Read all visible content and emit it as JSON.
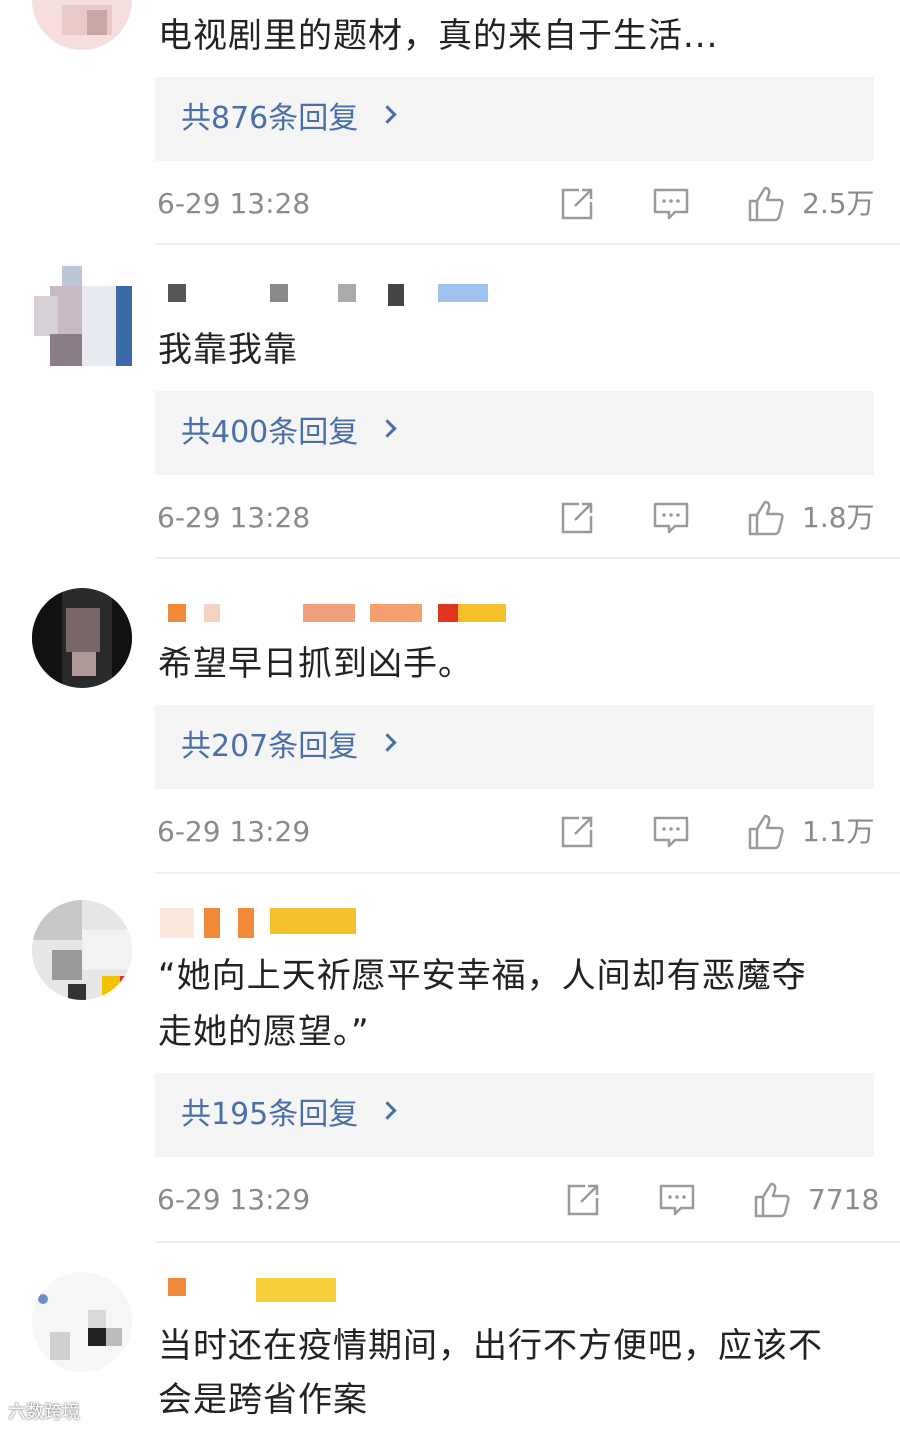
{
  "comments": [
    {
      "text": "电视剧里的题材，真的来自于生活...",
      "replies_label": "共876条回复",
      "time": "6-29 13:28",
      "likes": "2.5万"
    },
    {
      "text": "我靠我靠",
      "replies_label": "共400条回复",
      "time": "6-29 13:28",
      "likes": "1.8万"
    },
    {
      "text": "希望早日抓到凶手。",
      "replies_label": "共207条回复",
      "time": "6-29 13:29",
      "likes": "1.1万"
    },
    {
      "text_line1": "“她向上天祈愿平安幸福，人间却有恶魔夺",
      "text_line2": "走她的愿望。”",
      "replies_label": "共195条回复",
      "time": "6-29 13:29",
      "likes": "7718"
    },
    {
      "text_line1": "当时还在疫情期间，出行不方便吧，应该不",
      "text_line2": "会是跨省作案"
    }
  ],
  "watermark": "六数跨境",
  "colors": {
    "reply_link": "#4a6ea9",
    "reply_bg": "#f5f5f5",
    "meta_text": "#8a8a8a",
    "icon_stroke": "#9a9a9a"
  },
  "icons": [
    "share-icon",
    "comment-icon",
    "like-icon",
    "chevron-right-icon"
  ]
}
